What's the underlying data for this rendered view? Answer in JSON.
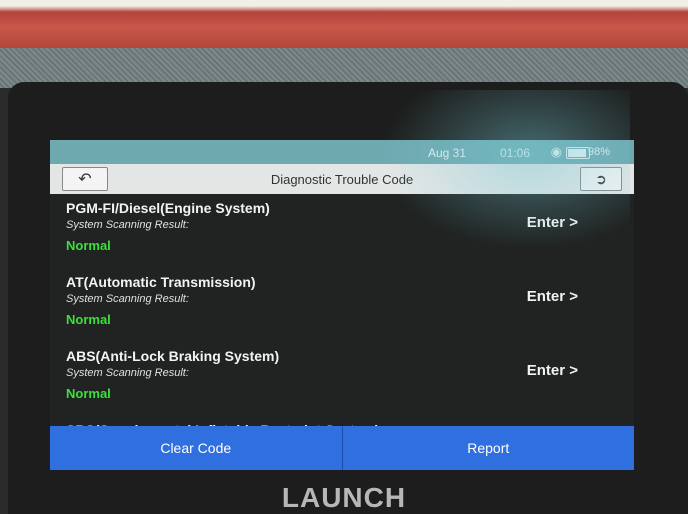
{
  "device": {
    "brand": "LAUNCH"
  },
  "status_bar": {
    "date": "Aug 31",
    "time": "01:06",
    "battery": "98%"
  },
  "header": {
    "title": "Diagnostic Trouble Code"
  },
  "icons": {
    "back": "back-arrow-icon",
    "exit": "exit-icon",
    "wifi": "wifi-icon",
    "battery": "battery-icon"
  },
  "systems": [
    {
      "name": "PGM-FI/Diesel(Engine System)",
      "result_label": "System Scanning Result:",
      "status": "Normal",
      "enter": "Enter >"
    },
    {
      "name": "AT(Automatic Transmission)",
      "result_label": "System Scanning Result:",
      "status": "Normal",
      "enter": "Enter >"
    },
    {
      "name": "ABS(Anti-Lock Braking System)",
      "result_label": "System Scanning Result:",
      "status": "Normal",
      "enter": "Enter >"
    },
    {
      "name": "SRS(Supplemental Inflatable Restraint System)"
    }
  ],
  "footer": {
    "clear_code": "Clear Code",
    "report": "Report"
  },
  "colors": {
    "accent": "#2f6fe0",
    "status_normal": "#3be03b",
    "casing": "#b3443a"
  }
}
